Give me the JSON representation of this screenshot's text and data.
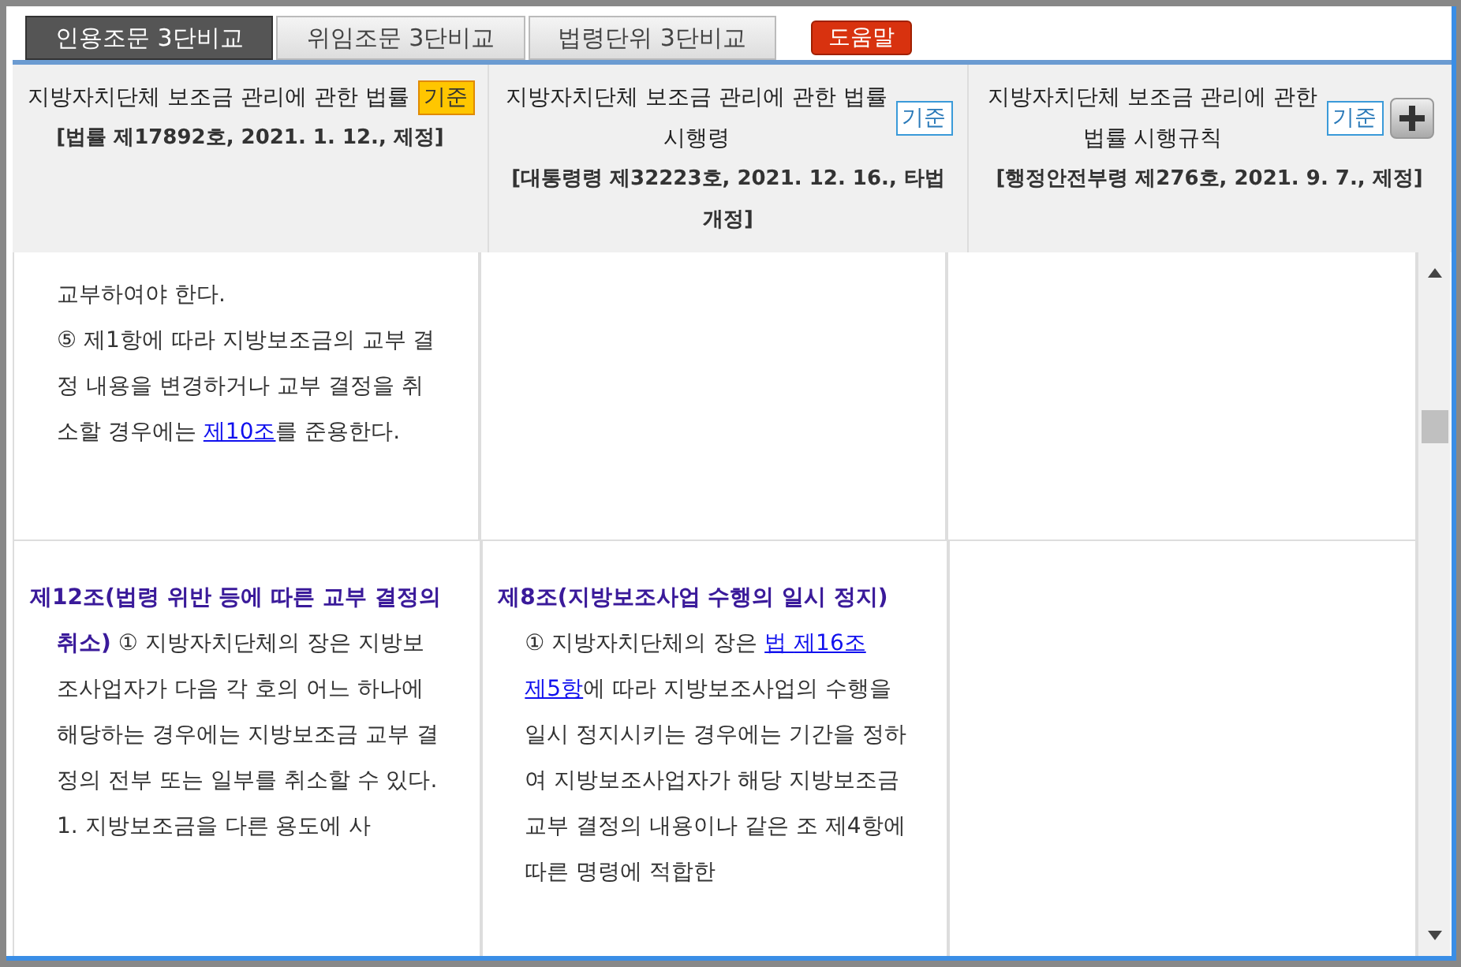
{
  "tabs": [
    {
      "label": "인용조문 3단비교",
      "selected": true
    },
    {
      "label": "위임조문 3단비교",
      "selected": false
    },
    {
      "label": "법령단위 3단비교",
      "selected": false
    }
  ],
  "help_button": "도움말",
  "columns": [
    {
      "title": "지방자치단체 보조금 관리에 관한 법률",
      "badge": "기준",
      "badge_highlighted": true,
      "info": "[법률 제17892호, 2021. 1. 12., 제정]"
    },
    {
      "title": "지방자치단체 보조금 관리에 관한 법률 시행령",
      "badge": "기준",
      "badge_highlighted": false,
      "info": "[대통령령 제32223호, 2021. 12. 16., 타법개정]"
    },
    {
      "title": "지방자치단체 보조금 관리에 관한 법률 시행규칙",
      "badge": "기준",
      "badge_highlighted": false,
      "info": "[행정안전부령 제276호, 2021. 9. 7., 제정]",
      "add_button": true
    }
  ],
  "rows": [
    {
      "cells": [
        {
          "paragraphs": [
            [
              {
                "kind": "text",
                "text": "교부하여야 한다."
              }
            ],
            [
              {
                "kind": "text",
                "text": "⑤ 제1항에 따라 지방보조금의 교부 결정 내용을 변경하거나 교부 결정을 취소할 경우에는 "
              },
              {
                "kind": "link",
                "text": "제10조"
              },
              {
                "kind": "text",
                "text": "를 준용한다."
              }
            ]
          ]
        },
        {},
        {}
      ]
    },
    {
      "cells": [
        {
          "heading": "제12조(법령 위반 등에 따른 교부 결정의 취소)",
          "paragraphs": [
            [
              {
                "kind": "text",
                "text": "① 지방자치단체의 장은 지방보조사업자가 다음 각 호의 어느 하나에 해당하는 경우에는 지방보조금 교부 결정의 전부 또는 일부를 취소할 수 있다."
              }
            ],
            [
              {
                "kind": "text",
                "text": "1. 지방보조금을 다른 용도에 사"
              }
            ]
          ]
        },
        {
          "heading": "제8조(지방보조사업 수행의 일시 정지)",
          "paragraphs": [
            [
              {
                "kind": "text",
                "text": "① 지방자치단체의 장은 "
              },
              {
                "kind": "link",
                "text": "법 "
              },
              {
                "kind": "link",
                "text": "제16조"
              },
              {
                "kind": "link",
                "text": "제5항"
              },
              {
                "kind": "text",
                "text": "에 따라 지방보조사업의 수행을 일시 정지시키는 경우에는 기간을 정하여 지방보조사업자가 해당 지방보조금 교부 결정의 내용이나 같은 조 제4항에 따른 명령에 적합한"
              }
            ]
          ]
        },
        {}
      ]
    }
  ]
}
